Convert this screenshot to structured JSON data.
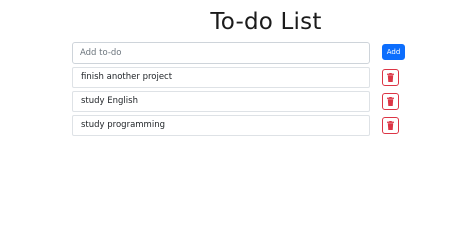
{
  "header": {
    "title": "To-do List"
  },
  "input": {
    "placeholder": "Add to-do",
    "value": ""
  },
  "add_button": {
    "label": "Add"
  },
  "todos": [
    {
      "text": "finish another project"
    },
    {
      "text": "study English"
    },
    {
      "text": "study programming"
    }
  ],
  "icons": {
    "delete": "trash-icon"
  },
  "colors": {
    "primary": "#0d6efd",
    "danger": "#dc3545",
    "border": "#dee2e6",
    "text": "#212529"
  }
}
